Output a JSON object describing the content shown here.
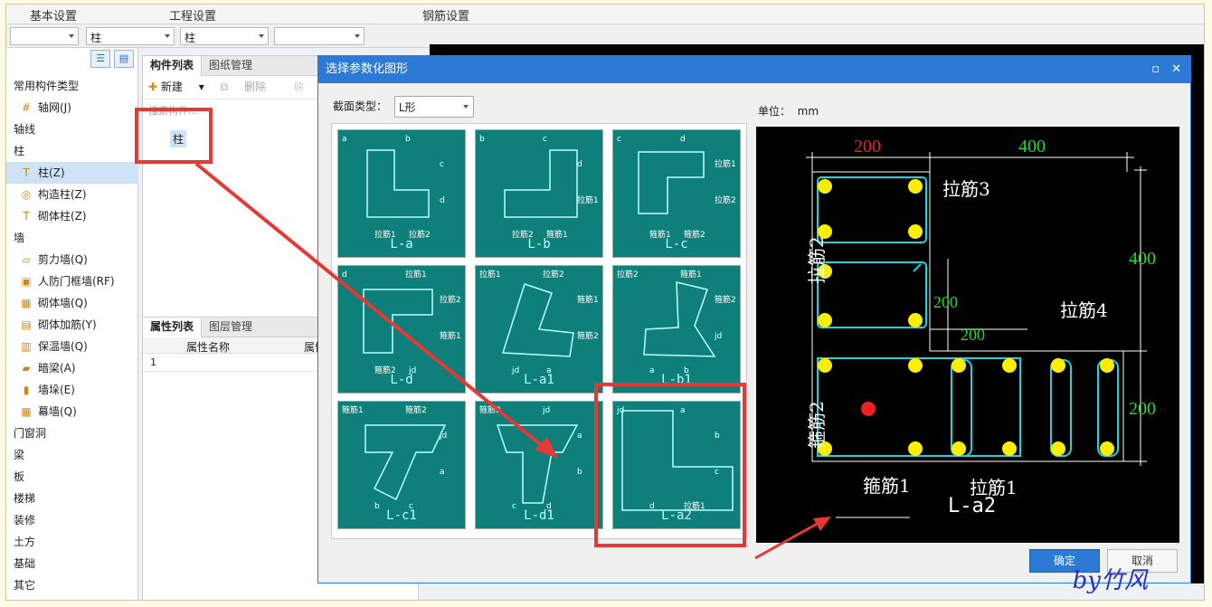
{
  "menubar": {
    "items": [
      "基本设置",
      "工程设置",
      "钢筋设置"
    ]
  },
  "dropdowns": [
    "",
    "柱",
    "柱",
    ""
  ],
  "left_tree": [
    {
      "label": "常用构件类型",
      "level": 0,
      "icon": ""
    },
    {
      "label": "轴网(J)",
      "level": 1,
      "icon": "#"
    },
    {
      "label": "轴线",
      "level": 0,
      "icon": ""
    },
    {
      "label": "柱",
      "level": 0,
      "icon": ""
    },
    {
      "label": "柱(Z)",
      "level": 1,
      "icon": "T",
      "selected": true
    },
    {
      "label": "构造柱(Z)",
      "level": 1,
      "icon": "◎"
    },
    {
      "label": "砌体柱(Z)",
      "level": 1,
      "icon": "T"
    },
    {
      "label": "墙",
      "level": 0,
      "icon": ""
    },
    {
      "label": "剪力墙(Q)",
      "level": 1,
      "icon": "▱"
    },
    {
      "label": "人防门框墙(RF)",
      "level": 1,
      "icon": "▣"
    },
    {
      "label": "砌体墙(Q)",
      "level": 1,
      "icon": "▦"
    },
    {
      "label": "砌体加筋(Y)",
      "level": 1,
      "icon": "▤"
    },
    {
      "label": "保温墙(Q)",
      "level": 1,
      "icon": "▥"
    },
    {
      "label": "暗梁(A)",
      "level": 1,
      "icon": "▰"
    },
    {
      "label": "墙垛(E)",
      "level": 1,
      "icon": "▮"
    },
    {
      "label": "幕墙(Q)",
      "level": 1,
      "icon": "▦"
    },
    {
      "label": "门窗洞",
      "level": 0,
      "icon": ""
    },
    {
      "label": "梁",
      "level": 0,
      "icon": ""
    },
    {
      "label": "板",
      "level": 0,
      "icon": ""
    },
    {
      "label": "楼梯",
      "level": 0,
      "icon": ""
    },
    {
      "label": "装修",
      "level": 0,
      "icon": ""
    },
    {
      "label": "土方",
      "level": 0,
      "icon": ""
    },
    {
      "label": "基础",
      "level": 0,
      "icon": ""
    },
    {
      "label": "其它",
      "level": 0,
      "icon": ""
    }
  ],
  "component_panel": {
    "tabs": [
      "构件列表",
      "图纸管理"
    ],
    "tools": [
      "新建",
      "删除",
      "复制"
    ],
    "search_placeholder": "搜索构件...",
    "item": "柱"
  },
  "property_panel": {
    "tabs": [
      "属性列表",
      "图层管理"
    ],
    "columns": [
      "属性名称",
      "属性"
    ],
    "row_index": "1"
  },
  "dialog": {
    "title": "选择参数化图形",
    "section_label": "截面类型：",
    "section_value": "L形",
    "unit_label": "单位：",
    "unit_value": "mm",
    "shapes": [
      "L-a",
      "L-b",
      "L-c",
      "L-d",
      "L-a1",
      "L-b1",
      "L-c1",
      "L-d1",
      "L-a2"
    ],
    "ok": "确定",
    "cancel": "取消",
    "preview": {
      "dims": [
        "200",
        "400",
        "400",
        "200",
        "200",
        "200"
      ],
      "labels": [
        "拉筋3",
        "拉筋2",
        "拉筋4",
        "箍筋2",
        "箍筋1",
        "拉筋1"
      ],
      "name": "L-a2"
    }
  },
  "thumb_labels": [
    "a",
    "b",
    "c",
    "d",
    "拉筋1",
    "拉筋2",
    "箍筋1",
    "箍筋2",
    "jd"
  ],
  "watermark": "by竹风",
  "colors": {
    "accent": "#2c7ad6",
    "teal": "#0f7f7a",
    "highlight": "#e53935",
    "green_dim": "#22dd22",
    "red_dim": "#ee2222"
  }
}
